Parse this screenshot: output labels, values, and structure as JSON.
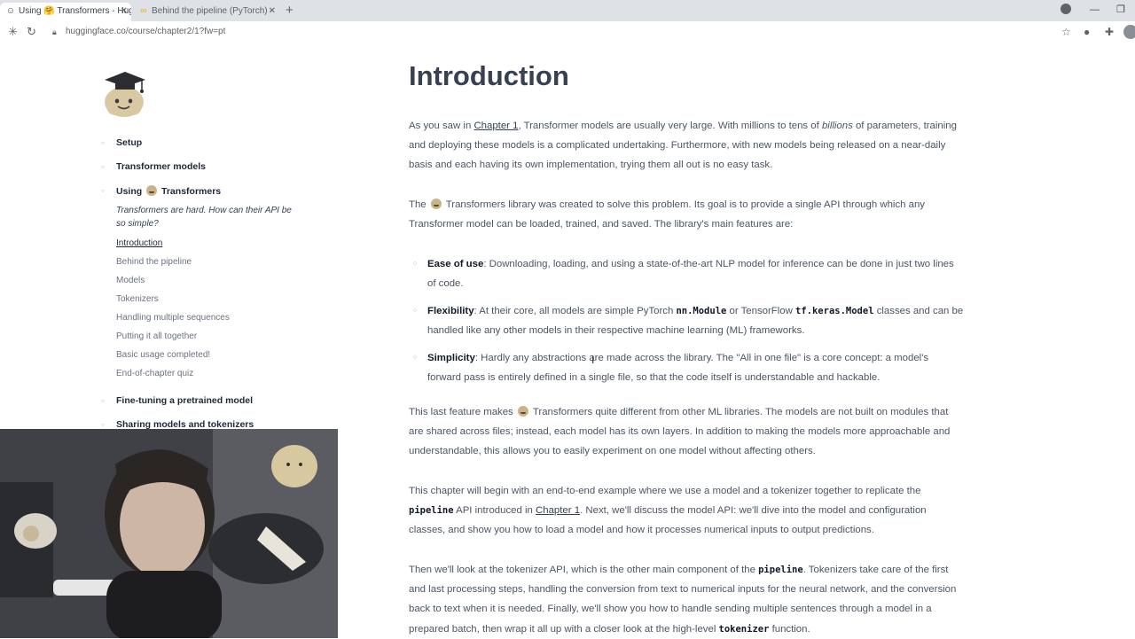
{
  "browser": {
    "tabs": [
      {
        "title": "Using 🤗 Transformers - Hugg",
        "icon": "hf-logo-icon",
        "active": true
      },
      {
        "title": "Behind the pipeline (PyTorch) -",
        "icon": "colab-icon",
        "active": false
      }
    ],
    "new_tab_label": "+",
    "url": "huggingface.co/course/chapter2/1?fw=pt"
  },
  "sidebar": {
    "chapters": [
      {
        "label": "Setup"
      },
      {
        "label": "Transformer models"
      },
      {
        "label_pre": "Using",
        "label_post": "Transformers"
      },
      {
        "label": "Fine-tuning a pretrained model"
      },
      {
        "label": "Sharing models and tokenizers"
      }
    ],
    "chapter_subtitle": "Transformers are hard. How can their API be so simple?",
    "sections": [
      {
        "label": "Introduction",
        "active": true
      },
      {
        "label": "Behind the pipeline",
        "active": false
      },
      {
        "label": "Models",
        "active": false
      },
      {
        "label": "Tokenizers",
        "active": false
      },
      {
        "label": "Handling multiple sequences",
        "active": false
      },
      {
        "label": "Putting it all together",
        "active": false
      },
      {
        "label": "Basic usage completed!",
        "active": false
      },
      {
        "label": "End-of-chapter quiz",
        "active": false
      }
    ]
  },
  "content": {
    "title": "Introduction",
    "p1": {
      "a": "As you saw in ",
      "link": "Chapter 1",
      "b": ", Transformer models are usually very large. With millions to tens of ",
      "em": "billions",
      "c": " of parameters, training and deploying these models is a complicated undertaking. Furthermore, with new models being released on a near-daily basis and each having its own implementation, trying them all out is no easy task."
    },
    "p2": {
      "a": "The ",
      "b": " Transformers library was created to solve this problem. Its goal is to provide a single API through which any Transformer model can be loaded, trained, and saved. The library's main features are:"
    },
    "features": [
      {
        "term": "Ease of use",
        "text": ": Downloading, loading, and using a state-of-the-art NLP model for inference can be done in just two lines of code."
      },
      {
        "term": "Flexibility",
        "text_a": ": At their core, all models are simple PyTorch ",
        "code_a": "nn.Module",
        "text_b": " or TensorFlow ",
        "code_b": "tf.keras.Model",
        "text_c": " classes and can be handled like any other models in their respective machine learning (ML) frameworks."
      },
      {
        "term": "Simplicity",
        "text": ": Hardly any abstractions are made across the library. The \"All in one file\" is a core concept: a model's forward pass is entirely defined in a single file, so that the code itself is understandable and hackable."
      }
    ],
    "p3": {
      "a": "This last feature makes ",
      "b": " Transformers quite different from other ML libraries. The models are not built on modules that are shared across files; instead, each model has its own layers. In addition to making the models more approachable and understandable, this allows you to easily experiment on one model without affecting others."
    },
    "p4": {
      "a": "This chapter will begin with an end-to-end example where we use a model and a tokenizer together to replicate the ",
      "code": "pipeline",
      "b": " API introduced in ",
      "link": "Chapter 1",
      "c": ". Next, we'll discuss the model API: we'll dive into the model and configuration classes, and show you how to load a model and how it processes numerical inputs to output predictions."
    },
    "p5": {
      "a": "Then we'll look at the tokenizer API, which is the other main component of the ",
      "code_a": "pipeline",
      "b": ". Tokenizers take care of the first and last processing steps, handling the conversion from text to numerical inputs for the neural network, and the conversion back to text when it is needed. Finally, we'll show you how to handle sending multiple sentences through a model in a prepared batch, then wrap it all up with a closer look at the high-level ",
      "code_b": "tokenizer",
      "c": " function."
    }
  }
}
